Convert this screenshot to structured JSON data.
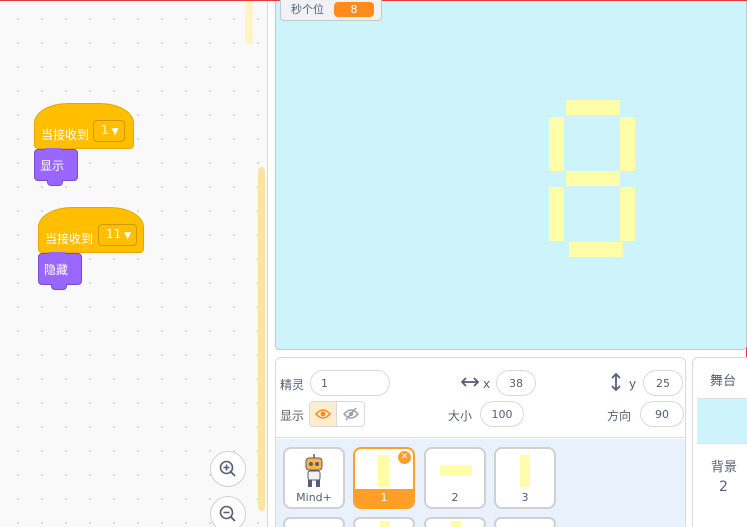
{
  "code_area": {
    "scripts": [
      {
        "hat_label": "当接收到",
        "message": "1",
        "action_label": "显示"
      },
      {
        "hat_label": "当接收到",
        "message": "11",
        "action_label": "隐藏"
      }
    ]
  },
  "stage": {
    "monitor": {
      "label": "秒个位",
      "value": "8"
    },
    "display_digit": "8",
    "segment_color": "#fffdaa",
    "background_color": "#cdf3fb"
  },
  "sprite_info": {
    "sprite_label": "精灵",
    "sprite_name": "1",
    "x_label": "x",
    "x_value": "38",
    "y_label": "y",
    "y_value": "25",
    "show_label": "显示",
    "size_label": "大小",
    "size_value": "100",
    "direction_label": "方向",
    "direction_value": "90"
  },
  "sprites": [
    {
      "name": "Mind+"
    },
    {
      "name": "1"
    },
    {
      "name": "2"
    },
    {
      "name": "3"
    }
  ],
  "stage_panel": {
    "title": "舞台",
    "backdrops_label": "背景",
    "backdrops_count": "2"
  },
  "icons": [
    "zoom-in-icon",
    "zoom-out-icon",
    "horizontal-arrows-icon",
    "vertical-arrows-icon",
    "eye-icon",
    "eye-slash-icon",
    "delete-icon",
    "mind-plus-robot-icon",
    "chevron-down-icon"
  ]
}
